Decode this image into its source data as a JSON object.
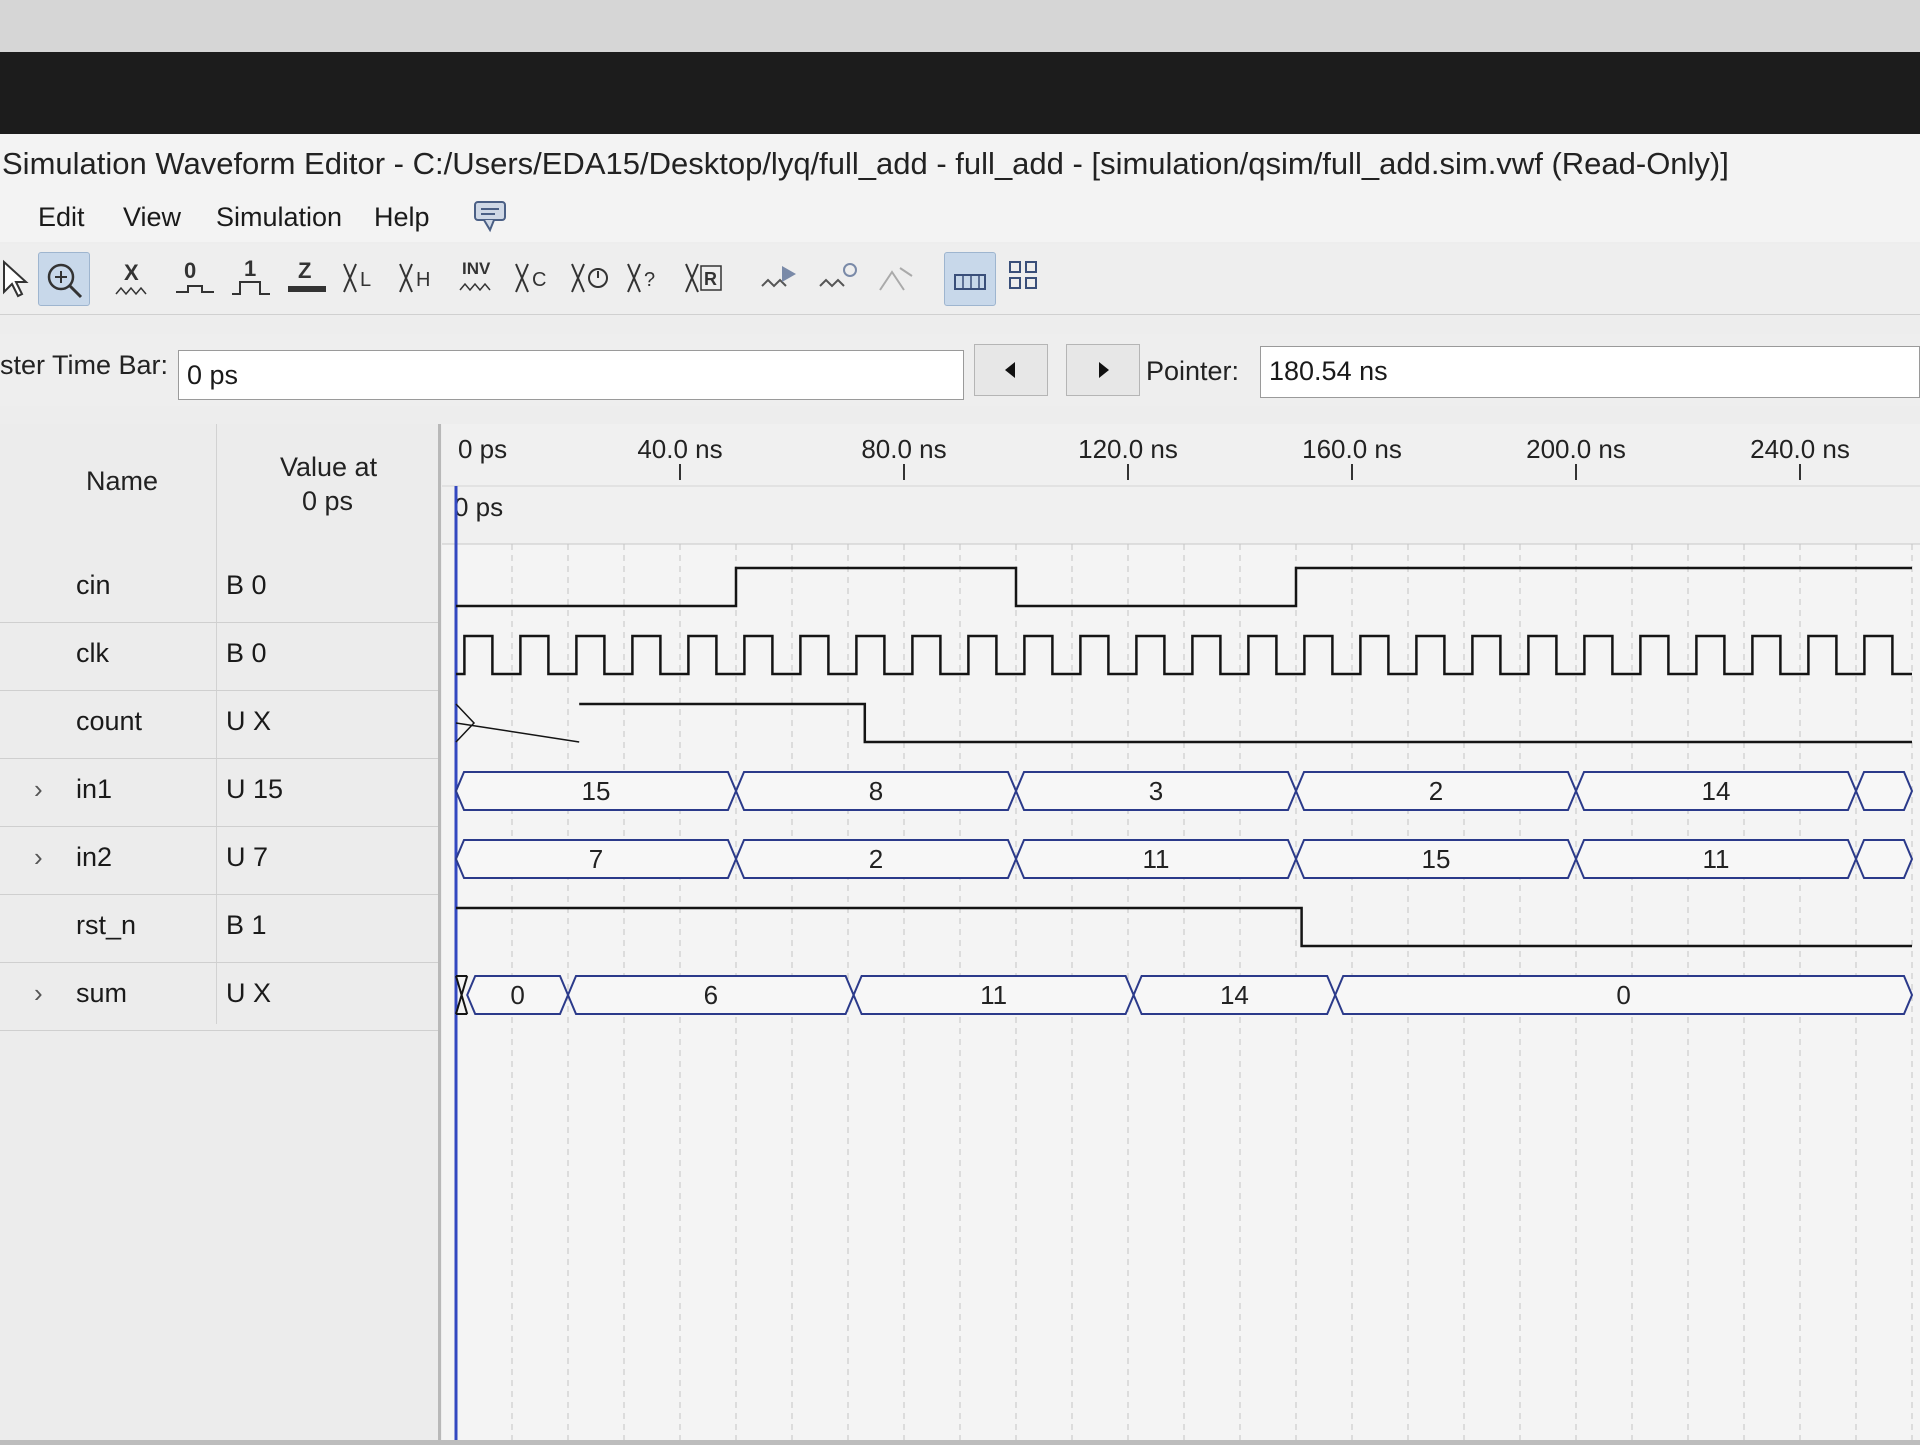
{
  "window": {
    "title": "Simulation Waveform Editor - C:/Users/EDA15/Desktop/lyq/full_add - full_add - [simulation/qsim/full_add.sim.vwf (Read-Only)]"
  },
  "menu": {
    "items": [
      {
        "label": "Edit"
      },
      {
        "label": "View"
      },
      {
        "label": "Simulation"
      },
      {
        "label": "Help"
      }
    ]
  },
  "toolbar": {
    "tools": [
      {
        "icon": "selection-pointer-icon"
      },
      {
        "icon": "zoom-tool-icon",
        "active": true
      },
      {
        "icon": "forcing-unknown-icon",
        "glyph": "X"
      },
      {
        "icon": "forcing-low-icon",
        "glyph": "0"
      },
      {
        "icon": "forcing-high-icon",
        "glyph": "1"
      },
      {
        "icon": "high-impedance-icon",
        "glyph": "Z"
      },
      {
        "icon": "weak-low-icon",
        "glyph": "L"
      },
      {
        "icon": "weak-high-icon",
        "glyph": "H"
      },
      {
        "icon": "invert-icon",
        "glyph": "INV"
      },
      {
        "icon": "count-value-icon",
        "glyph": "C"
      },
      {
        "icon": "clock-value-icon",
        "glyph": "◷"
      },
      {
        "icon": "arbitrary-value-icon",
        "glyph": "?"
      },
      {
        "icon": "random-value-icon",
        "glyph": "R"
      },
      {
        "icon": "run-functional-simulation-icon"
      },
      {
        "icon": "run-timing-simulation-icon"
      },
      {
        "icon": "generate-netlist-icon"
      },
      {
        "icon": "snap-to-grid-icon",
        "active": true
      },
      {
        "icon": "grid-settings-icon"
      }
    ]
  },
  "timebar": {
    "master_label": "ster Time Bar:",
    "master_value": "0 ps",
    "pointer_label": "Pointer:",
    "pointer_value": "180.54 ns"
  },
  "name_panel": {
    "name_header": "Name",
    "value_header_line1": "Value at",
    "value_header_line2": "0 ps"
  },
  "signals": [
    {
      "name": "cin",
      "value": "B 0",
      "expandable": false,
      "type": "bit",
      "edges_ns": [
        0,
        50,
        100,
        150
      ],
      "levels": [
        0,
        1,
        0,
        1
      ]
    },
    {
      "name": "clk",
      "value": "B 0",
      "expandable": false,
      "type": "clock",
      "period_ns": 10
    },
    {
      "name": "count",
      "value": "U X",
      "expandable": false,
      "type": "bit",
      "edges_ns": [
        0,
        22,
        73
      ],
      "levels": [
        "X",
        1,
        0
      ]
    },
    {
      "name": "in1",
      "value": "U 15",
      "expandable": true,
      "type": "bus",
      "segments": [
        {
          "from": 0,
          "to": 50,
          "label": "15"
        },
        {
          "from": 50,
          "to": 100,
          "label": "8"
        },
        {
          "from": 100,
          "to": 150,
          "label": "3"
        },
        {
          "from": 150,
          "to": 200,
          "label": "2"
        },
        {
          "from": 200,
          "to": 250,
          "label": "14"
        },
        {
          "from": 250,
          "to": 260,
          "label": ""
        }
      ]
    },
    {
      "name": "in2",
      "value": "U 7",
      "expandable": true,
      "type": "bus",
      "segments": [
        {
          "from": 0,
          "to": 50,
          "label": "7"
        },
        {
          "from": 50,
          "to": 100,
          "label": "2"
        },
        {
          "from": 100,
          "to": 150,
          "label": "11"
        },
        {
          "from": 150,
          "to": 200,
          "label": "15"
        },
        {
          "from": 200,
          "to": 250,
          "label": "11"
        },
        {
          "from": 250,
          "to": 260,
          "label": ""
        }
      ]
    },
    {
      "name": "rst_n",
      "value": "B 1",
      "expandable": false,
      "type": "bit",
      "edges_ns": [
        0,
        151
      ],
      "levels": [
        1,
        0
      ]
    },
    {
      "name": "sum",
      "value": "U X",
      "expandable": true,
      "type": "bus",
      "segments": [
        {
          "from": 0,
          "to": 2,
          "label": "",
          "unknown": true
        },
        {
          "from": 2,
          "to": 20,
          "label": "0"
        },
        {
          "from": 20,
          "to": 71,
          "label": "6"
        },
        {
          "from": 71,
          "to": 121,
          "label": "11"
        },
        {
          "from": 121,
          "to": 157,
          "label": "14"
        },
        {
          "from": 157,
          "to": 260,
          "label": "0"
        }
      ]
    }
  ],
  "waveform": {
    "start_label": "0 ps",
    "ticks": [
      {
        "t": 0,
        "label": "0 ps"
      },
      {
        "t": 40,
        "label": "40.0 ns"
      },
      {
        "t": 80,
        "label": "80.0 ns"
      },
      {
        "t": 120,
        "label": "120.0 ns"
      },
      {
        "t": 160,
        "label": "160.0 ns"
      },
      {
        "t": 200,
        "label": "200.0 ns"
      },
      {
        "t": 240,
        "label": "240.0 ns"
      }
    ],
    "grid_step_ns": 10,
    "visible_end_ns": 260
  },
  "colors": {
    "trace": "#141414",
    "bus_outline": "#2b3a8a",
    "cursor": "#3348c0",
    "grid": "#c4c4c4"
  }
}
